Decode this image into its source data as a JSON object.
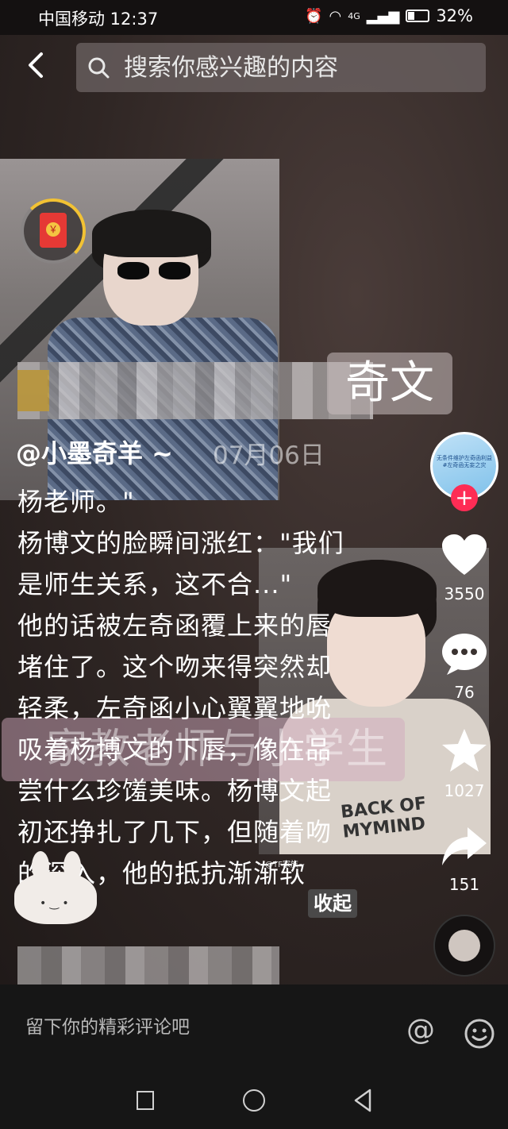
{
  "status_bar": {
    "carrier_time": "中国移动 12:37",
    "network": "4G",
    "battery": "32%"
  },
  "search": {
    "placeholder": "搜索你感兴趣的内容"
  },
  "post": {
    "tag_top": "奇文",
    "author": "@小墨奇羊 ~",
    "date": "07月06日",
    "lines": [
      "杨老师。\"",
      "杨博文的脸瞬间涨红：\"我们",
      "是师生关系，这不合...\"",
      "他的话被左奇函覆上来的唇",
      "堵住了。这个吻来得突然却",
      "轻柔，左奇函小心翼翼地吮",
      "吸着杨博文的下唇，像在品",
      "尝什么珍馐美味。杨博文起",
      "初还挣扎了几下，但随着吻",
      "的深入，他的抵抗渐渐软"
    ],
    "overlay_tag": "家教老师与小学生",
    "collapse_label": "收起",
    "photo2_print": "BACK OF MYMIND",
    "photo2_watermark": "@TF家族~"
  },
  "sidebar": {
    "avatar_text": "无条件维护左奇函利益 #左奇函无妄之灾",
    "follow": "+",
    "likes": "3550",
    "comments": "76",
    "favorites": "1027",
    "shares": "151"
  },
  "comment_bar": {
    "placeholder": "留下你的精彩评论吧",
    "at": "@"
  },
  "colors": {
    "follow_red": "#fe2c55",
    "redpacket_red": "#e53935",
    "ring_gold": "#f2c233"
  }
}
